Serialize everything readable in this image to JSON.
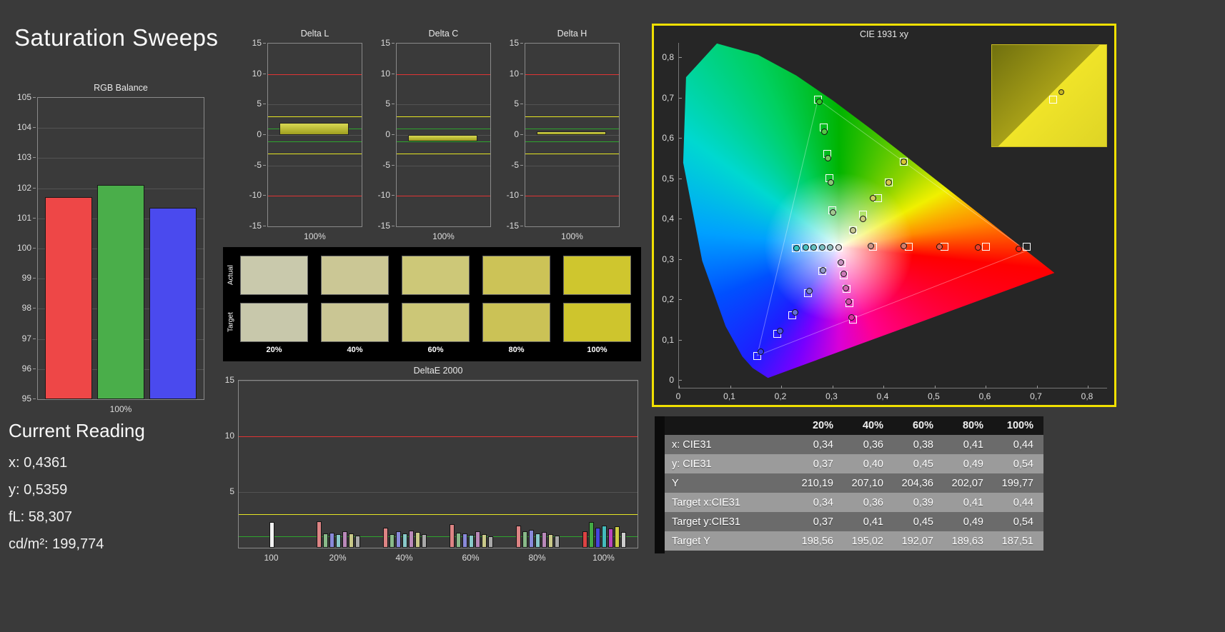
{
  "page": {
    "title": "Saturation Sweeps"
  },
  "current_reading": {
    "title": "Current Reading",
    "lines": [
      "x: 0,4361",
      "y: 0,5359",
      "fL: 58,307",
      "cd/m²: 199,774"
    ]
  },
  "swatches": {
    "row_labels": [
      "Actual",
      "Target"
    ],
    "col_labels": [
      "20%",
      "40%",
      "60%",
      "80%",
      "100%"
    ],
    "actual": [
      "#c9c9ac",
      "#cbc795",
      "#cdc878",
      "#ccc357",
      "#cfc62e"
    ],
    "target": [
      "#c8c8ab",
      "#cac694",
      "#ccc777",
      "#cbc256",
      "#cec52d"
    ]
  },
  "table": {
    "headers": [
      "",
      "20%",
      "40%",
      "60%",
      "80%",
      "100%"
    ],
    "rows": [
      {
        "label": "x: CIE31",
        "values": [
          "0,34",
          "0,36",
          "0,38",
          "0,41",
          "0,44"
        ]
      },
      {
        "label": "y: CIE31",
        "values": [
          "0,37",
          "0,40",
          "0,45",
          "0,49",
          "0,54"
        ]
      },
      {
        "label": "Y",
        "values": [
          "210,19",
          "207,10",
          "204,36",
          "202,07",
          "199,77"
        ]
      },
      {
        "label": "Target x:CIE31",
        "values": [
          "0,34",
          "0,36",
          "0,39",
          "0,41",
          "0,44"
        ]
      },
      {
        "label": "Target y:CIE31",
        "values": [
          "0,37",
          "0,41",
          "0,45",
          "0,49",
          "0,54"
        ]
      },
      {
        "label": "Target Y",
        "values": [
          "198,56",
          "195,02",
          "192,07",
          "189,63",
          "187,51"
        ]
      }
    ]
  },
  "chart_data": {
    "rgb_balance": {
      "type": "bar",
      "title": "RGB Balance",
      "xlabel": "100%",
      "ymin": 95,
      "ymax": 105,
      "yticks": [
        "105",
        "104",
        "103",
        "102",
        "101",
        "100",
        "99",
        "98",
        "97",
        "96",
        "95"
      ],
      "bars": [
        {
          "name": "red",
          "value": 101.7,
          "color": "#ee4747"
        },
        {
          "name": "green",
          "value": 102.1,
          "color": "#4aae4a"
        },
        {
          "name": "blue",
          "value": 101.35,
          "color": "#4a4aee"
        }
      ]
    },
    "delta_charts": {
      "type": "bar",
      "ymin": -15,
      "ymax": 15,
      "yticks": [
        "15",
        "10",
        "5",
        "0",
        "-5",
        "-10",
        "-15"
      ],
      "xlabel": "100%",
      "bar_colors": [
        "#d9d952",
        "#9e9e1e"
      ],
      "limit_lines": [
        {
          "value": 10,
          "color": "#e03434"
        },
        {
          "value": -10,
          "color": "#e03434"
        },
        {
          "value": 3,
          "color": "#e6e623"
        },
        {
          "value": -3,
          "color": "#e6e623"
        },
        {
          "value": 1,
          "color": "#2ea52e"
        },
        {
          "value": -1,
          "color": "#2ea52e"
        }
      ],
      "charts": [
        {
          "title": "Delta L",
          "value": 2.0
        },
        {
          "title": "Delta C",
          "value": -1.1
        },
        {
          "title": "Delta H",
          "value": 0.6
        }
      ]
    },
    "deltae": {
      "type": "bar",
      "title": "DeltaE 2000",
      "ymax": 15,
      "yticks": [
        "15",
        "10",
        "5"
      ],
      "limits": [
        {
          "value": 10,
          "color": "#e03434"
        },
        {
          "value": 3,
          "color": "#e6e623"
        },
        {
          "value": 1,
          "color": "#2ea52e"
        }
      ],
      "groups": [
        {
          "label": "100",
          "bars": [
            {
              "color": "#f2f2f2",
              "value": 2.3
            }
          ]
        },
        {
          "label": "20%",
          "bars": [
            {
              "color": "#dd8484",
              "value": 2.4
            },
            {
              "color": "#89b989",
              "value": 1.3
            },
            {
              "color": "#8989d9",
              "value": 1.35
            },
            {
              "color": "#89c9c9",
              "value": 1.2
            },
            {
              "color": "#b989b9",
              "value": 1.5
            },
            {
              "color": "#c9c989",
              "value": 1.3
            },
            {
              "color": "#a9a9a9",
              "value": 1.1
            }
          ]
        },
        {
          "label": "40%",
          "bars": [
            {
              "color": "#dd8484",
              "value": 1.8
            },
            {
              "color": "#89b989",
              "value": 1.25
            },
            {
              "color": "#8989d9",
              "value": 1.5
            },
            {
              "color": "#89c9c9",
              "value": 1.3
            },
            {
              "color": "#b989b9",
              "value": 1.55
            },
            {
              "color": "#c9c989",
              "value": 1.4
            },
            {
              "color": "#a9a9a9",
              "value": 1.2
            }
          ]
        },
        {
          "label": "60%",
          "bars": [
            {
              "color": "#dd8484",
              "value": 2.1
            },
            {
              "color": "#89b989",
              "value": 1.35
            },
            {
              "color": "#8989d9",
              "value": 1.3
            },
            {
              "color": "#89c9c9",
              "value": 1.15
            },
            {
              "color": "#b989b9",
              "value": 1.5
            },
            {
              "color": "#c9c989",
              "value": 1.25
            },
            {
              "color": "#a9a9a9",
              "value": 1.0
            }
          ]
        },
        {
          "label": "80%",
          "bars": [
            {
              "color": "#dd8484",
              "value": 2.0
            },
            {
              "color": "#89b989",
              "value": 1.5
            },
            {
              "color": "#8989d9",
              "value": 1.6
            },
            {
              "color": "#89c9c9",
              "value": 1.3
            },
            {
              "color": "#b989b9",
              "value": 1.4
            },
            {
              "color": "#c9c989",
              "value": 1.2
            },
            {
              "color": "#a9a9a9",
              "value": 1.1
            }
          ]
        },
        {
          "label": "100%",
          "bars": [
            {
              "color": "#dd4444",
              "value": 1.5
            },
            {
              "color": "#44aa44",
              "value": 2.3
            },
            {
              "color": "#4444dd",
              "value": 1.8
            },
            {
              "color": "#44bbbb",
              "value": 2.0
            },
            {
              "color": "#bb44bb",
              "value": 1.7
            },
            {
              "color": "#cccc44",
              "value": 1.9
            },
            {
              "color": "#cccccc",
              "value": 1.4
            }
          ]
        }
      ]
    },
    "cie": {
      "type": "scatter",
      "title": "CIE 1931 xy",
      "xlim": [
        0,
        0.8
      ],
      "ylim": [
        0,
        0.8
      ],
      "xticks": [
        "0",
        "0,1",
        "0,2",
        "0,3",
        "0,4",
        "0,5",
        "0,6",
        "0,7",
        "0,8"
      ],
      "yticks": [
        "0",
        "0,1",
        "0,2",
        "0,3",
        "0,4",
        "0,5",
        "0,6",
        "0,7",
        "0,8"
      ],
      "border_color": "#f0e000",
      "white_point": [
        0.313,
        0.329
      ],
      "gamut_triangle": [
        [
          0.68,
          0.32
        ],
        [
          0.272,
          0.695
        ],
        [
          0.153,
          0.06
        ]
      ],
      "targets": [
        [
          0.313,
          0.329
        ],
        [
          0.38,
          0.33
        ],
        [
          0.45,
          0.33
        ],
        [
          0.52,
          0.33
        ],
        [
          0.6,
          0.33
        ],
        [
          0.68,
          0.33
        ],
        [
          0.3,
          0.42
        ],
        [
          0.295,
          0.5
        ],
        [
          0.29,
          0.56
        ],
        [
          0.283,
          0.625
        ],
        [
          0.272,
          0.695
        ],
        [
          0.28,
          0.27
        ],
        [
          0.252,
          0.215
        ],
        [
          0.222,
          0.16
        ],
        [
          0.193,
          0.115
        ],
        [
          0.153,
          0.06
        ],
        [
          0.34,
          0.37
        ],
        [
          0.36,
          0.41
        ],
        [
          0.39,
          0.45
        ],
        [
          0.41,
          0.49
        ],
        [
          0.44,
          0.54
        ],
        [
          0.318,
          0.29
        ],
        [
          0.323,
          0.26
        ],
        [
          0.328,
          0.225
        ],
        [
          0.333,
          0.19
        ],
        [
          0.34,
          0.15
        ],
        [
          0.295,
          0.329
        ],
        [
          0.278,
          0.329
        ],
        [
          0.262,
          0.328
        ],
        [
          0.247,
          0.328
        ],
        [
          0.228,
          0.327
        ]
      ],
      "measured": [
        [
          0.313,
          0.329,
          "#d8d8d8"
        ],
        [
          0.375,
          0.332,
          "#cc9488"
        ],
        [
          0.44,
          0.331,
          "#d47c68"
        ],
        [
          0.51,
          0.33,
          "#e05c48"
        ],
        [
          0.585,
          0.328,
          "#ee3c28"
        ],
        [
          0.665,
          0.325,
          "#f52012"
        ],
        [
          0.302,
          0.415,
          "#a2c890"
        ],
        [
          0.297,
          0.49,
          "#8ac878"
        ],
        [
          0.292,
          0.55,
          "#6ec85c"
        ],
        [
          0.285,
          0.615,
          "#50c844"
        ],
        [
          0.275,
          0.69,
          "#30c824"
        ],
        [
          0.282,
          0.272,
          "#929ac8"
        ],
        [
          0.255,
          0.22,
          "#7a84d0"
        ],
        [
          0.227,
          0.168,
          "#626cd8"
        ],
        [
          0.198,
          0.122,
          "#4a54e0"
        ],
        [
          0.16,
          0.07,
          "#323ce8"
        ],
        [
          0.34,
          0.37,
          "#c8c894"
        ],
        [
          0.36,
          0.4,
          "#ccc87c"
        ],
        [
          0.38,
          0.45,
          "#d0c862"
        ],
        [
          0.41,
          0.49,
          "#d4c84a"
        ],
        [
          0.44,
          0.54,
          "#d8c832"
        ],
        [
          0.317,
          0.292,
          "#c892c0"
        ],
        [
          0.322,
          0.262,
          "#cc7ab8"
        ],
        [
          0.327,
          0.228,
          "#d062b0"
        ],
        [
          0.332,
          0.193,
          "#d44aa8"
        ],
        [
          0.338,
          0.155,
          "#d832a0"
        ],
        [
          0.296,
          0.329,
          "#94c2c2"
        ],
        [
          0.28,
          0.329,
          "#7cc2c2"
        ],
        [
          0.264,
          0.328,
          "#64c2c2"
        ],
        [
          0.248,
          0.328,
          "#4cc2c2"
        ],
        [
          0.23,
          0.327,
          "#34c2c2"
        ]
      ],
      "inset": {
        "dark_color": "#70700e",
        "mid_color": "#a8a018",
        "bright_color": "#f0e428",
        "bright2_color": "#ded426"
      }
    }
  }
}
